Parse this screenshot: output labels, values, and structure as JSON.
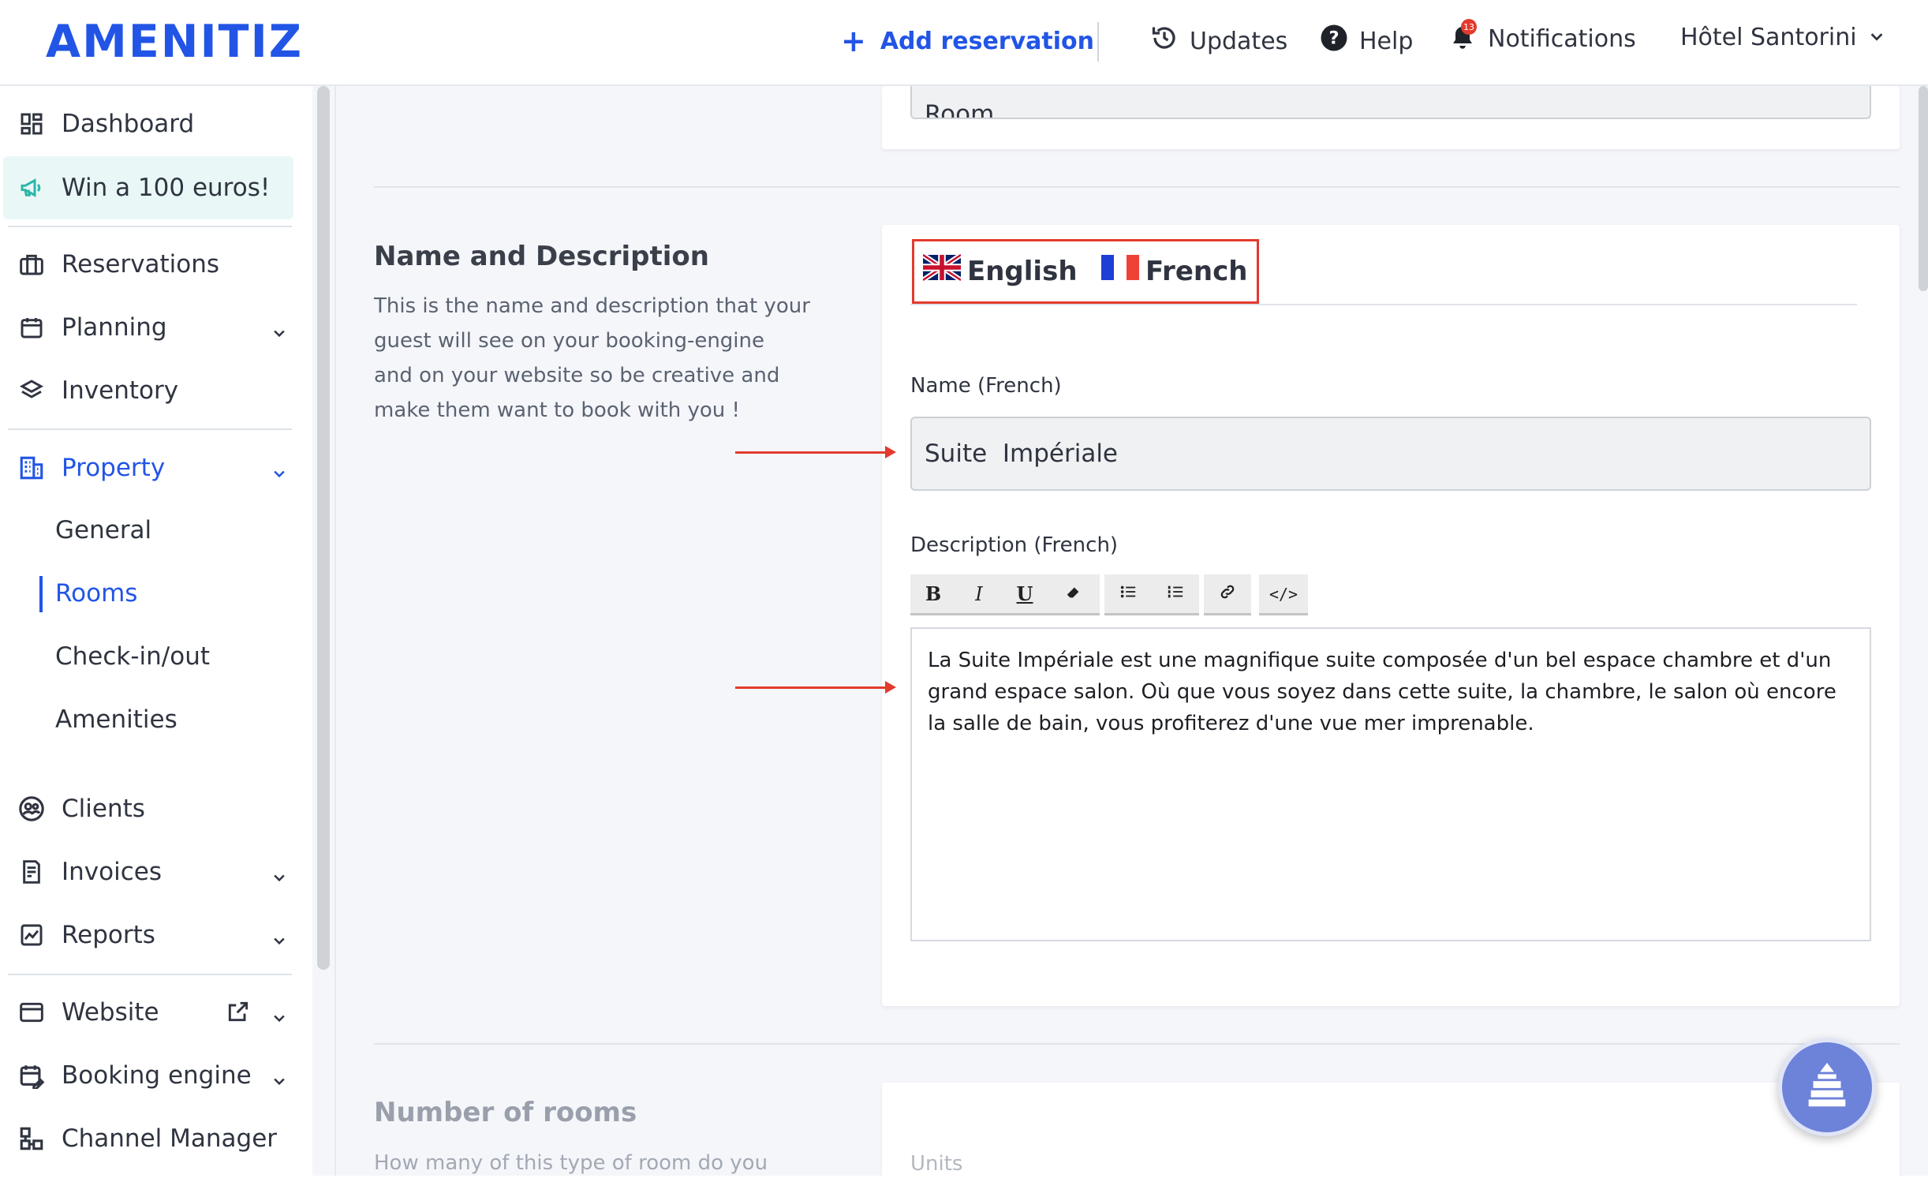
{
  "header": {
    "logo": "AMENITIZ",
    "add_reservation": "Add reservation",
    "updates": "Updates",
    "help": "Help",
    "notifications": "Notifications",
    "notification_count": "13",
    "hotel": "Hôtel Santorini"
  },
  "sidebar": {
    "items": [
      {
        "label": "Dashboard",
        "icon": "dashboard-icon"
      },
      {
        "label": "Win a 100 euros!",
        "icon": "megaphone-icon"
      },
      {
        "label": "Reservations",
        "icon": "briefcase-icon"
      },
      {
        "label": "Planning",
        "icon": "calendar-icon"
      },
      {
        "label": "Inventory",
        "icon": "layers-icon"
      },
      {
        "label": "Property",
        "icon": "building-icon"
      },
      {
        "label": "Clients",
        "icon": "users-icon"
      },
      {
        "label": "Invoices",
        "icon": "invoice-icon"
      },
      {
        "label": "Reports",
        "icon": "chart-icon"
      },
      {
        "label": "Website",
        "icon": "browser-icon"
      },
      {
        "label": "Booking engine",
        "icon": "calendar-edit-icon"
      },
      {
        "label": "Channel Manager",
        "icon": "channels-icon"
      }
    ],
    "property_sub": [
      "General",
      "Rooms",
      "Check-in/out",
      "Amenities"
    ],
    "active_color": "#2255e6",
    "promo_bg": "#e9f8f7"
  },
  "name_section": {
    "title": "Name and Description",
    "description": [
      "This is the name and description that your",
      "guest will see on your booking-engine",
      "and on your website so be creative and",
      "make them want to book with you !"
    ],
    "tabs": [
      "English",
      "French"
    ],
    "name_label": "Name (French)",
    "name_value": "Suite  Impériale",
    "desc_label": "Description (French)",
    "toolbar": [
      "B",
      "I",
      "U",
      "eraser",
      "bullet-list",
      "numbered-list",
      "link",
      "</>"
    ],
    "desc_value": "La Suite Impériale est une magnifique suite composée d'un bel espace chambre et d'un grand espace salon. Où que vous soyez dans cette suite, la chambre, le salon où encore la salle de bain, vous profiterez d'une vue mer imprenable."
  },
  "rooms_section": {
    "title": "Number of rooms",
    "description": "How many of this type of room do you",
    "units_placeholder": "Units"
  },
  "top_card": {
    "partial_text": "Room"
  },
  "colors": {
    "brand": "#2255e6",
    "highlight": "#e23b2e"
  }
}
